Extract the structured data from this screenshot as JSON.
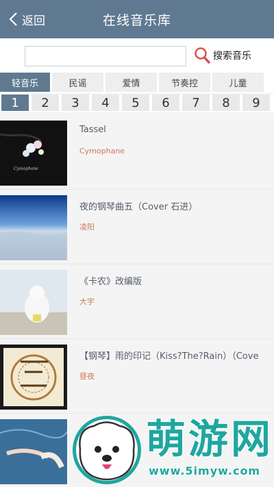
{
  "header": {
    "back_label": "返回",
    "title": "在线音乐库"
  },
  "search": {
    "value": "",
    "placeholder": "",
    "button_label": "搜索音乐"
  },
  "tabs": [
    {
      "label": "轻音乐",
      "active": true
    },
    {
      "label": "民谣"
    },
    {
      "label": "爱情"
    },
    {
      "label": "节奏控"
    },
    {
      "label": "儿童"
    }
  ],
  "pages": [
    "1",
    "2",
    "3",
    "4",
    "5",
    "6",
    "7",
    "8",
    "9"
  ],
  "songs": [
    {
      "title": "Tassel",
      "artist": "Cymophane"
    },
    {
      "title": "夜的钢琴曲五（Cover 石进）",
      "artist": "凌阳"
    },
    {
      "title": "《卡农》改编版",
      "artist": "大宇"
    },
    {
      "title": "【钢琴】雨的印记（Kiss?The?Rain）（Cove",
      "artist": "昼夜"
    },
    {
      "title": "",
      "artist": ""
    }
  ],
  "watermark": {
    "title": "萌游网",
    "url": "www.5imyw.com"
  },
  "colors": {
    "accent": "#5f7a90",
    "artist": "#cf7a5a",
    "watermark": "#1ea7a0"
  }
}
